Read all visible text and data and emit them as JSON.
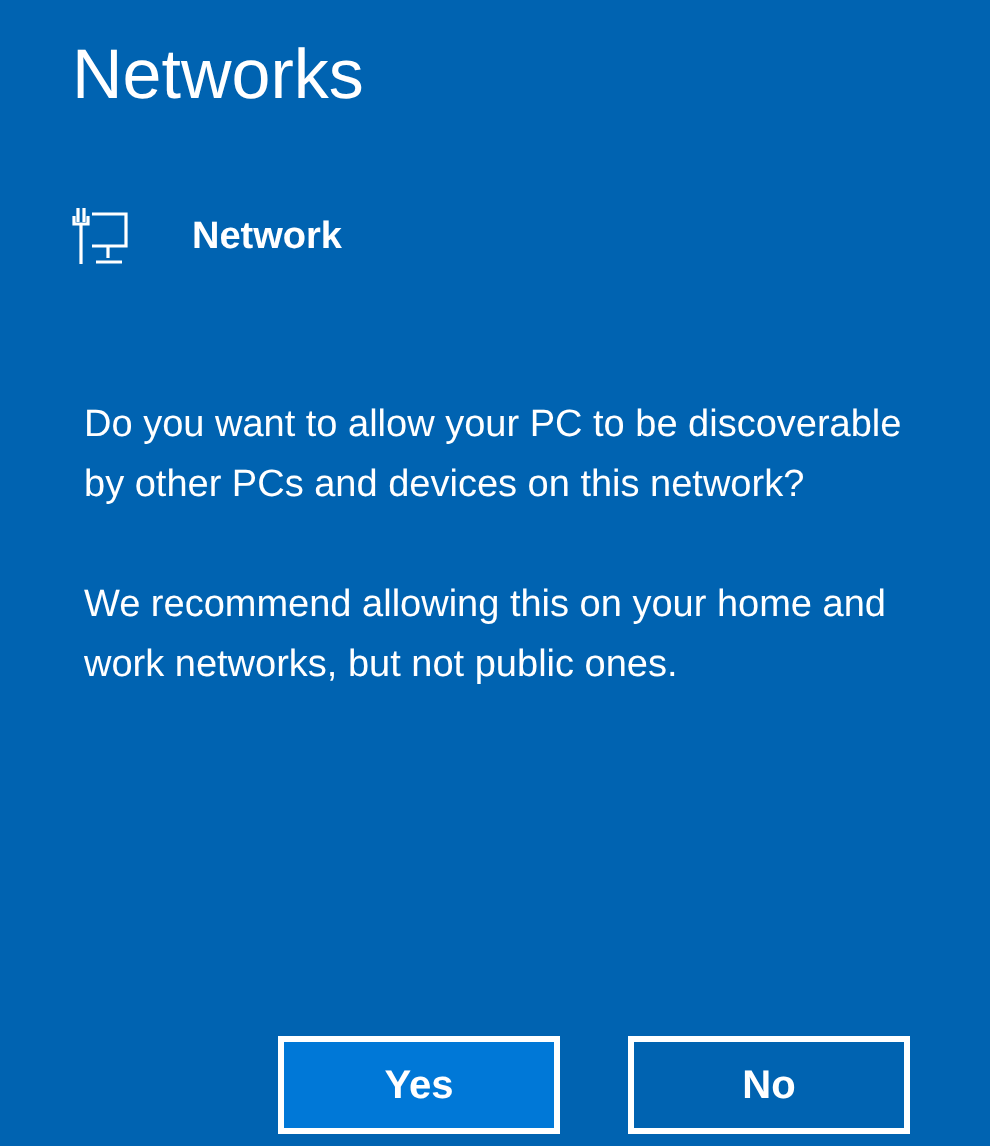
{
  "title": "Networks",
  "network": {
    "name": "Network"
  },
  "paragraphs": [
    "Do you want to allow your PC to be discoverable by other PCs and devices on this network?",
    "We recommend allowing this on your home and work networks, but not public ones."
  ],
  "buttons": [
    {
      "label": "Yes",
      "selected": true
    },
    {
      "label": "No",
      "selected": false
    }
  ]
}
